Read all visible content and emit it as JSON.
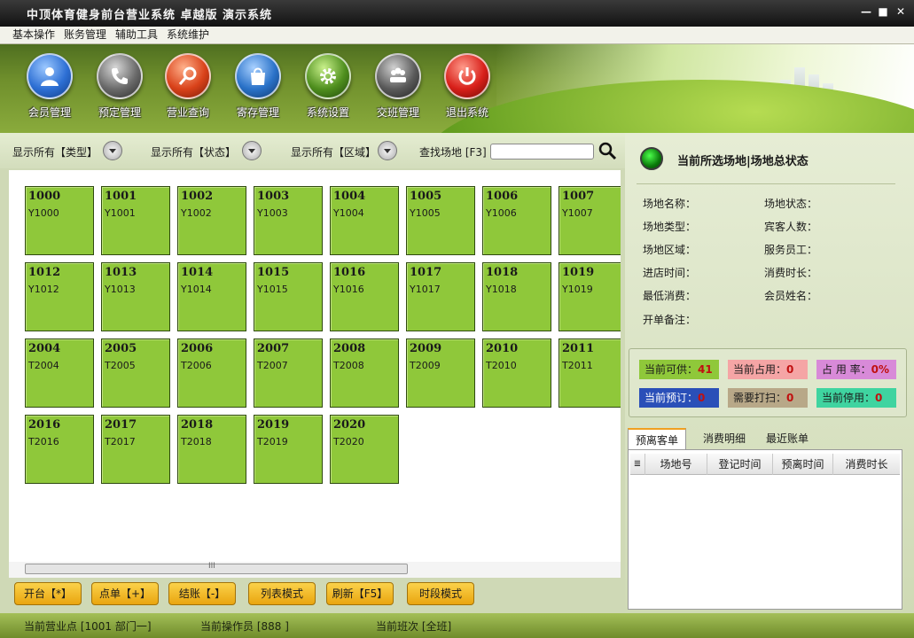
{
  "window": {
    "title": "中顶体育健身前台营业系统 卓越版 演示系统",
    "min": "—",
    "max": "■",
    "close": "✕"
  },
  "menu": [
    "基本操作",
    "账务管理",
    "辅助工具",
    "系统维护"
  ],
  "toolbar": [
    {
      "label": "会员管理",
      "icon": "member-icon",
      "color": "#2d6fd4"
    },
    {
      "label": "预定管理",
      "icon": "phone-icon",
      "color": "#6a6a6a"
    },
    {
      "label": "营业查询",
      "icon": "magnifier-icon",
      "color": "#d9421a"
    },
    {
      "label": "寄存管理",
      "icon": "bag-icon",
      "color": "#2a72c8"
    },
    {
      "label": "系统设置",
      "icon": "gear-icon",
      "color": "#4f8f1e"
    },
    {
      "label": "交班管理",
      "icon": "people-icon",
      "color": "#5a5a5a"
    },
    {
      "label": "退出系统",
      "icon": "power-icon",
      "color": "#d8201a"
    }
  ],
  "filters": {
    "type": "显示所有【类型】",
    "status": "显示所有【状态】",
    "area": "显示所有【区域】",
    "search_label": "查找场地 [F3]",
    "search_value": ""
  },
  "venues": [
    [
      {
        "no": "1000",
        "code": "Y1000"
      },
      {
        "no": "1001",
        "code": "Y1001"
      },
      {
        "no": "1002",
        "code": "Y1002"
      },
      {
        "no": "1003",
        "code": "Y1003"
      },
      {
        "no": "1004",
        "code": "Y1004"
      },
      {
        "no": "1005",
        "code": "Y1005"
      },
      {
        "no": "1006",
        "code": "Y1006"
      },
      {
        "no": "1007",
        "code": "Y1007"
      }
    ],
    [
      {
        "no": "1012",
        "code": "Y1012"
      },
      {
        "no": "1013",
        "code": "Y1013"
      },
      {
        "no": "1014",
        "code": "Y1014"
      },
      {
        "no": "1015",
        "code": "Y1015"
      },
      {
        "no": "1016",
        "code": "Y1016"
      },
      {
        "no": "1017",
        "code": "Y1017"
      },
      {
        "no": "1018",
        "code": "Y1018"
      },
      {
        "no": "1019",
        "code": "Y1019"
      }
    ],
    [
      {
        "no": "2004",
        "code": "T2004"
      },
      {
        "no": "2005",
        "code": "T2005"
      },
      {
        "no": "2006",
        "code": "T2006"
      },
      {
        "no": "2007",
        "code": "T2007"
      },
      {
        "no": "2008",
        "code": "T2008"
      },
      {
        "no": "2009",
        "code": "T2009"
      },
      {
        "no": "2010",
        "code": "T2010"
      },
      {
        "no": "2011",
        "code": "T2011"
      }
    ],
    [
      {
        "no": "2016",
        "code": "T2016"
      },
      {
        "no": "2017",
        "code": "T2017"
      },
      {
        "no": "2018",
        "code": "T2018"
      },
      {
        "no": "2019",
        "code": "T2019"
      },
      {
        "no": "2020",
        "code": "T2020"
      }
    ]
  ],
  "scrollbar_grip": "III",
  "actions": [
    "开台【*】",
    "点单【+】",
    "结账【-】",
    "列表模式",
    "刷新【F5】",
    "时段模式"
  ],
  "status_bar": {
    "point": "当前营业点 [1001 部门一]",
    "operator": "当前操作员 [888 ]",
    "shift": "当前班次 [全班]"
  },
  "detail": {
    "title": "当前所选场地|场地总状态",
    "fields": {
      "name": "场地名称：",
      "status": "场地状态：",
      "type": "场地类型：",
      "guests": "宾客人数：",
      "area": "场地区域：",
      "staff": "服务员工：",
      "checkin": "进店时间：",
      "duration": "消费时长：",
      "min_spend": "最低消费：",
      "member": "会员姓名：",
      "note": "开单备注："
    }
  },
  "stats": {
    "available": {
      "label": "当前可供：",
      "value": "41",
      "color": "#8fc83a"
    },
    "occupied": {
      "label": "当前占用：",
      "value": "0",
      "color": "#f5a5a5"
    },
    "rate": {
      "label": "占 用 率：",
      "value": "0%",
      "color": "#d88ad8"
    },
    "reserved": {
      "label": "当前预订：",
      "value": "0",
      "color": "#2a4fb8"
    },
    "cleaning": {
      "label": "需要打扫：",
      "value": "0",
      "color": "#b8a888"
    },
    "stopped": {
      "label": "当前停用：",
      "value": "0",
      "color": "#3fd4a0"
    }
  },
  "tabs": [
    "预离客单",
    "消费明细",
    "最近账单"
  ],
  "table_headers": [
    "场地号",
    "登记时间",
    "预离时间",
    "消费时长"
  ]
}
